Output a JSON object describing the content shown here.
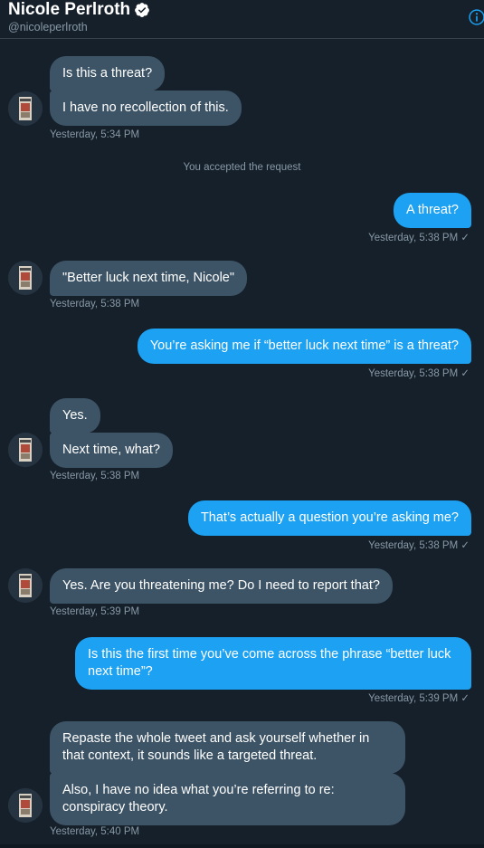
{
  "header": {
    "name": "Nicole Perlroth",
    "handle": "@nicoleperlroth"
  },
  "messages": [
    {
      "id": "m1",
      "text": "Is this a threat?"
    },
    {
      "id": "m2",
      "text": "I have no recollection of this."
    },
    {
      "id": "t1",
      "text": "Yesterday, 5:34 PM"
    },
    {
      "id": "sys1",
      "text": "You accepted the request"
    },
    {
      "id": "m3",
      "text": "A threat?"
    },
    {
      "id": "t2",
      "text": "Yesterday, 5:38 PM ✓"
    },
    {
      "id": "m4",
      "text": "\"Better luck next time, Nicole\""
    },
    {
      "id": "t3",
      "text": "Yesterday, 5:38 PM"
    },
    {
      "id": "m5",
      "text": "You’re asking me if “better luck next time” is a threat?"
    },
    {
      "id": "t4",
      "text": "Yesterday, 5:38 PM ✓"
    },
    {
      "id": "m6",
      "text": "Yes."
    },
    {
      "id": "m7",
      "text": "Next time, what?"
    },
    {
      "id": "t5",
      "text": "Yesterday, 5:38 PM"
    },
    {
      "id": "m8",
      "text": "That’s actually a question you’re asking me?"
    },
    {
      "id": "t6",
      "text": "Yesterday, 5:38 PM ✓"
    },
    {
      "id": "m9",
      "text": "Yes. Are you threatening me? Do I need to report that?"
    },
    {
      "id": "t7",
      "text": "Yesterday, 5:39 PM"
    },
    {
      "id": "m10",
      "text": "Is this the first time you’ve come across the phrase “better luck next time”?"
    },
    {
      "id": "t8",
      "text": "Yesterday, 5:39 PM ✓"
    },
    {
      "id": "m11",
      "text": "Repaste the whole tweet and ask yourself whether in that context, it sounds like a targeted threat."
    },
    {
      "id": "m12",
      "text": "Also, I have no idea what you’re referring to re: conspiracy theory."
    },
    {
      "id": "t9",
      "text": "Yesterday, 5:40 PM"
    }
  ],
  "colors": {
    "background": "#15202b",
    "incoming_bubble": "#3d5466",
    "outgoing_bubble": "#1da1f2",
    "muted_text": "#8899a6"
  }
}
